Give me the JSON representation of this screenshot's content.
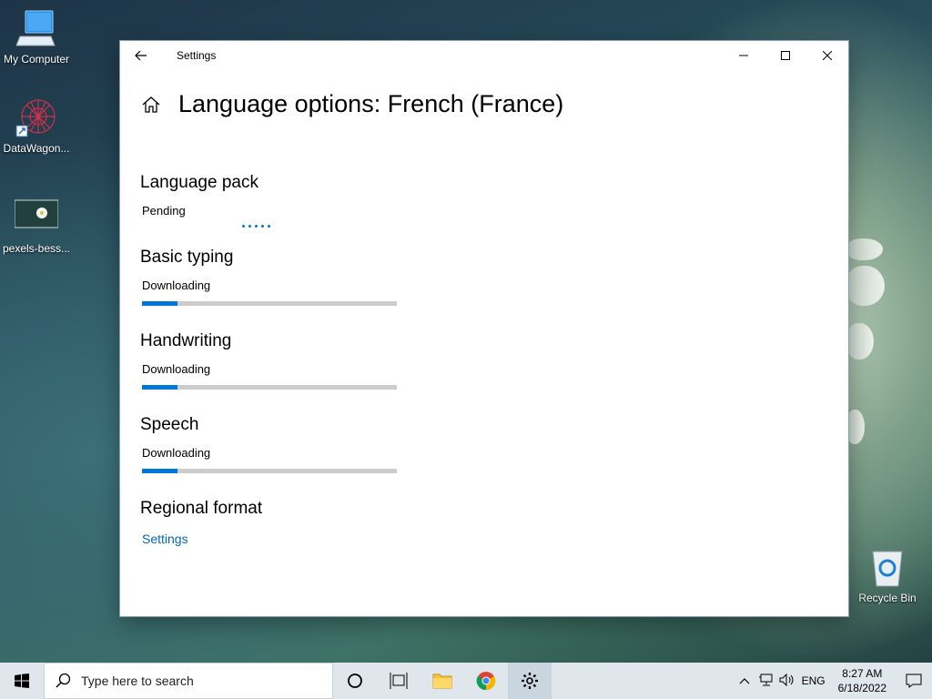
{
  "desktop": {
    "icons": [
      {
        "label": "My Computer"
      },
      {
        "label": "DataWagon..."
      },
      {
        "label": "pexels-bess..."
      },
      {
        "label": "Recycle Bin"
      }
    ]
  },
  "window": {
    "title": "Settings",
    "page_title": "Language options: French (France)",
    "sections": {
      "language_pack": {
        "heading": "Language pack",
        "status": "Pending"
      },
      "basic_typing": {
        "heading": "Basic typing",
        "status": "Downloading",
        "progress": 0.14
      },
      "handwriting": {
        "heading": "Handwriting",
        "status": "Downloading",
        "progress": 0.14
      },
      "speech": {
        "heading": "Speech",
        "status": "Downloading",
        "progress": 0.14
      },
      "regional_format": {
        "heading": "Regional format",
        "link": "Settings"
      }
    }
  },
  "taskbar": {
    "search_placeholder": "Type here to search",
    "language": "ENG",
    "time": "8:27 AM",
    "date": "6/18/2022"
  },
  "colors": {
    "accent": "#0078d7",
    "link": "#0067b8",
    "taskbar": "#dfe6ec"
  }
}
